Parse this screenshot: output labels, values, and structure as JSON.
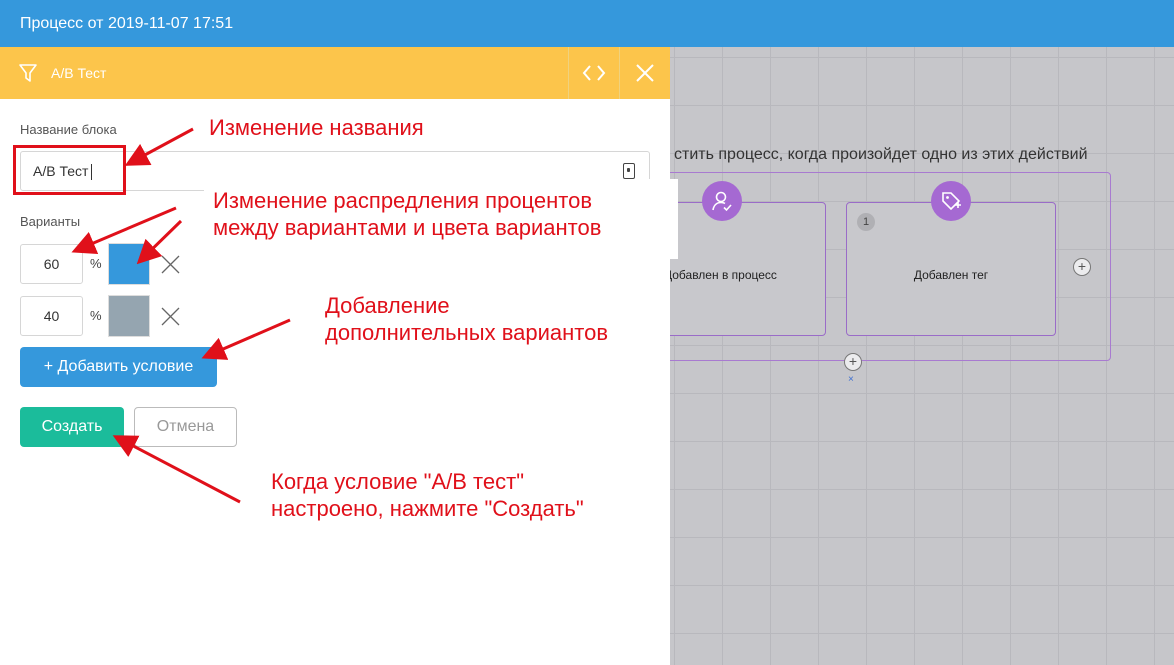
{
  "topbar": {
    "title": "Процесс от 2019-11-07 17:51"
  },
  "canvas": {
    "heading": "стить процесс, когда произойдет одно из этих действий",
    "nodes": [
      {
        "label": "Добавлен в процесс",
        "icon": "user-check-icon"
      },
      {
        "label": "Добавлен тег",
        "icon": "tag-plus-icon",
        "count": "1"
      }
    ],
    "add_symbol": "+",
    "remove_symbol": "×"
  },
  "panel": {
    "title": "А/В Тест",
    "block_name_label": "Название блока",
    "block_name_value": "А/В Тест",
    "variants_label": "Варианты",
    "variants": [
      {
        "percent": "60",
        "sign": "%",
        "color": "#3598dc"
      },
      {
        "percent": "40",
        "sign": "%",
        "color": "#95a5b0"
      }
    ],
    "add_condition_label": "+ Добавить условие",
    "create_label": "Создать",
    "cancel_label": "Отмена"
  },
  "annotations": {
    "rename": "Изменение названия",
    "distribution": "Изменение распредления процентов\nмежду вариантами и цвета вариантов",
    "add_variants": "Добавление\nдополнительных вариантов",
    "create_hint": "Когда условие \"А/В тест\"\nнастроено, нажмите \"Создать\""
  },
  "colors": {
    "annotation": "#e0101a",
    "header": "#fcc54b",
    "topbar": "#3598dc",
    "create": "#1bbc9b"
  }
}
